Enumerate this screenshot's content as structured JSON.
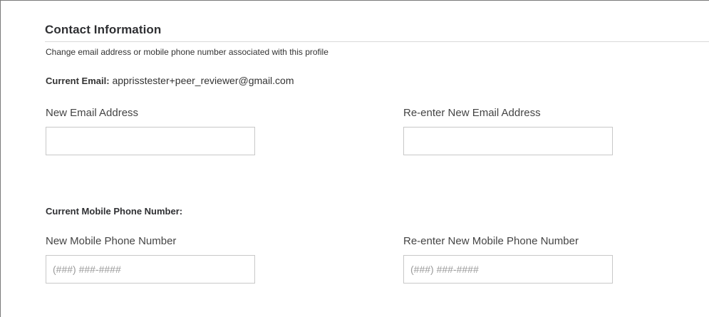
{
  "section": {
    "title": "Contact Information",
    "subtitle": "Change email address or mobile phone number associated with this profile"
  },
  "email": {
    "current_label": "Current Email:",
    "current_value": "apprisstester+peer_reviewer@gmail.com",
    "new_label": "New Email Address",
    "new_value": "",
    "reenter_label": "Re-enter New Email Address",
    "reenter_value": ""
  },
  "phone": {
    "current_label": "Current Mobile Phone Number:",
    "new_label": "New Mobile Phone Number",
    "new_placeholder": "(###) ###-####",
    "reenter_label": "Re-enter New Mobile Phone Number",
    "reenter_placeholder": "(###) ###-####"
  }
}
